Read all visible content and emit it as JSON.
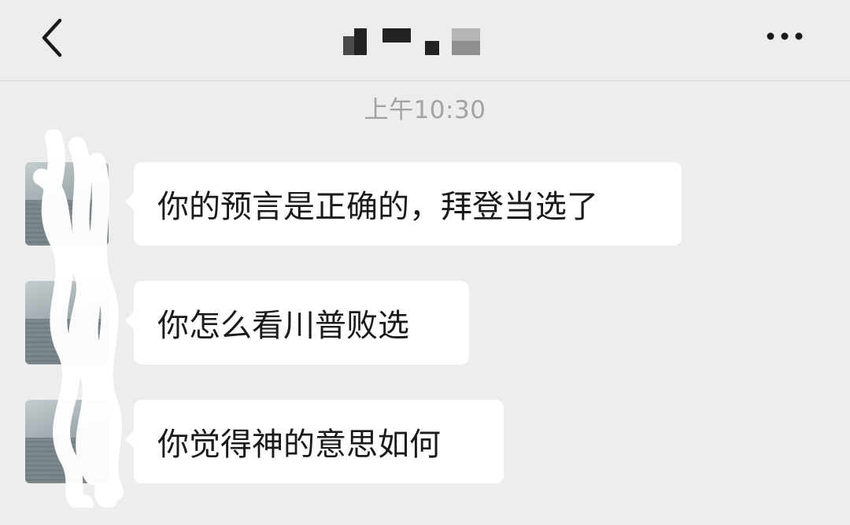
{
  "navbar": {
    "back_icon": "chevron-left-icon",
    "title_redacted": true,
    "more_icon": "more-horizontal-icon"
  },
  "chat": {
    "timestamp": "上午10:30",
    "messages": [
      {
        "sender": "other",
        "text": "你的预言是正确的，拜登当选了"
      },
      {
        "sender": "other",
        "text": "你怎么看川普败选"
      },
      {
        "sender": "other",
        "text": "你觉得神的意思如何"
      }
    ]
  },
  "colors": {
    "background": "#ededed",
    "bubble": "#ffffff",
    "timestamp_text": "#a3a3a3",
    "message_text": "#1a1a1a"
  }
}
